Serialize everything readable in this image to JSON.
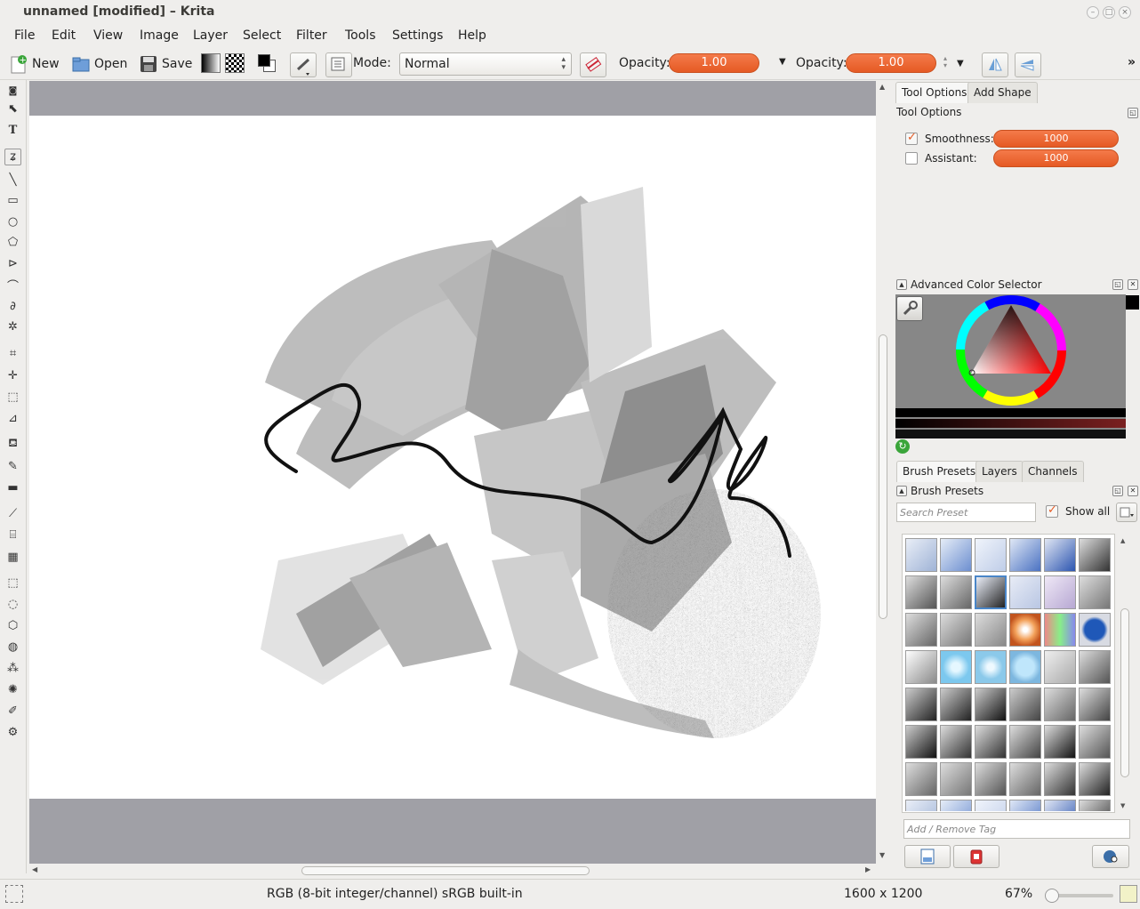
{
  "window": {
    "title": "unnamed [modified] – Krita"
  },
  "menu": [
    "File",
    "Edit",
    "View",
    "Image",
    "Layer",
    "Select",
    "Filter",
    "Tools",
    "Settings",
    "Help"
  ],
  "toolbar": {
    "new_label": "New",
    "open_label": "Open",
    "save_label": "Save",
    "mode_label": "Mode:",
    "mode_value": "Normal",
    "opacity_label_1": "Opacity:",
    "opacity_value_1": "1.00",
    "opacity_label_2": "Opacity:",
    "opacity_value_2": "1.00",
    "overflow_glyph": "»"
  },
  "tool_options": {
    "tabs": [
      "Tool Options",
      "Add Shape"
    ],
    "title": "Tool Options",
    "smoothness_label": "Smoothness:",
    "smoothness_value": "1000",
    "smoothness_checked": true,
    "assistant_label": "Assistant:",
    "assistant_value": "1000",
    "assistant_checked": false
  },
  "color_selector": {
    "title": "Advanced Color Selector",
    "hue_color": "#ff0000",
    "foreground_color": "#000000"
  },
  "brush_panel": {
    "tabs": [
      "Brush Presets",
      "Layers",
      "Channels"
    ],
    "title": "Brush Presets",
    "search_placeholder": "Search Preset",
    "show_all_label": "Show all",
    "show_all_checked": true,
    "tag_placeholder": "Add / Remove Tag"
  },
  "status": {
    "color_info": "RGB (8-bit integer/channel)  sRGB built-in",
    "dimensions": "1600 x 1200",
    "zoom": "67%"
  },
  "colors": {
    "accent": "#e55a24",
    "canvas_bg": "#a0a0a6"
  }
}
